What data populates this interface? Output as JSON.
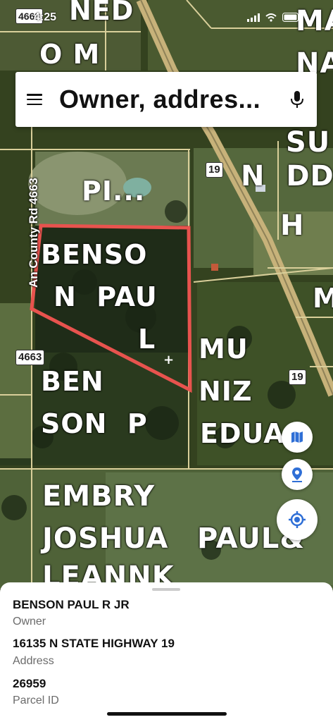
{
  "status_bar": {
    "time": "4:25",
    "location_badge": "4663"
  },
  "search": {
    "placeholder": "Owner, addres..."
  },
  "parcels": [
    {
      "text": "NED",
      "id": "p-ned"
    },
    {
      "text": "O M",
      "id": "p-om"
    },
    {
      "text": "MA",
      "id": "p-ma"
    },
    {
      "text": "NA",
      "id": "p-na"
    },
    {
      "text": "SU",
      "id": "p-su"
    },
    {
      "text": "N  DD",
      "id": "p-ndd"
    },
    {
      "text": "H",
      "id": "p-h"
    },
    {
      "text": "PI...",
      "id": "p-pi"
    },
    {
      "text": "BENSO",
      "id": "p-benso"
    },
    {
      "text": "N  PAU",
      "id": "p-npau"
    },
    {
      "text": "L",
      "id": "p-l"
    },
    {
      "text": "M",
      "id": "p-m"
    },
    {
      "text": "MU",
      "id": "p-mu"
    },
    {
      "text": "NIZ",
      "id": "p-niz"
    },
    {
      "text": "EDUA",
      "id": "p-edua"
    },
    {
      "text": "BEN",
      "id": "p-ben"
    },
    {
      "text": "SON  P",
      "id": "p-sonp"
    },
    {
      "text": "EMBRY",
      "id": "p-embry"
    },
    {
      "text": "JOSHUA",
      "id": "p-joshua"
    },
    {
      "text": "PAUL&",
      "id": "p-paul"
    },
    {
      "text": "LEANNK",
      "id": "p-leannk"
    }
  ],
  "roads": {
    "county_road": "An County Rd 4663",
    "route_19_top": "19",
    "route_19_bottom": "19",
    "road_4663": "4663"
  },
  "selected_parcel": {
    "owner_value": "BENSON PAUL R JR",
    "owner_label": "Owner",
    "address_value": "16135 N STATE HIGHWAY 19",
    "address_label": "Address",
    "parcel_id_value": "26959",
    "parcel_id_label": "Parcel ID"
  },
  "colors": {
    "parcel_outline": "#e8534e",
    "parcel_lines": "#d9cf9a",
    "map_base": "#2f3d22"
  },
  "icons": [
    "menu-icon",
    "mic-icon",
    "map-layers-icon",
    "location-pin-icon",
    "my-location-icon",
    "wifi-icon",
    "battery-icon",
    "signal-icon"
  ]
}
